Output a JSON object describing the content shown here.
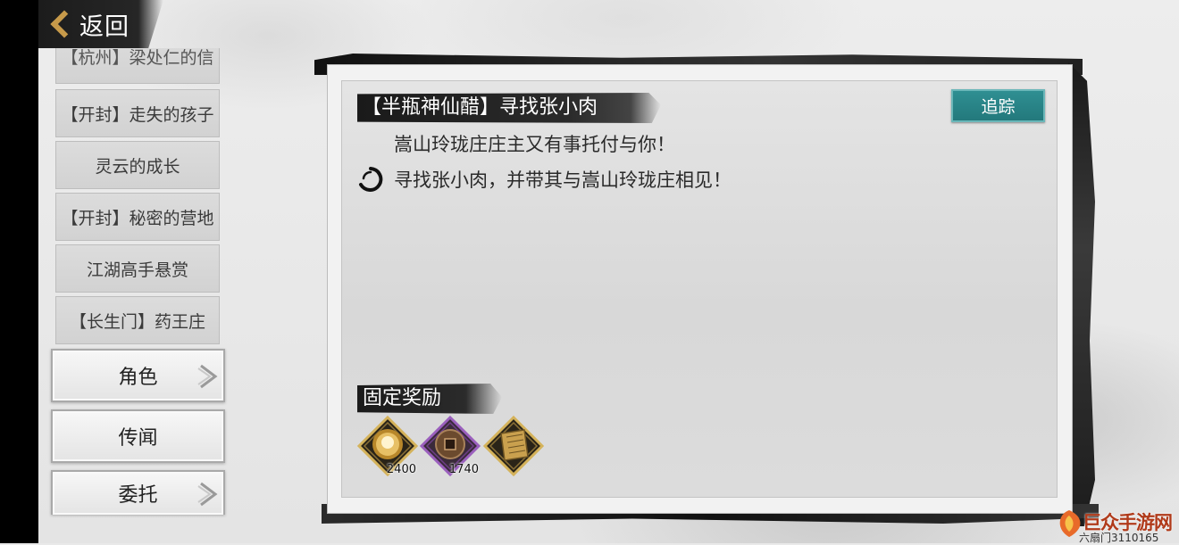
{
  "header": {
    "back_label": "返回"
  },
  "quest_list": [
    "【杭州】梁处仁的信",
    "【开封】走失的孩子",
    "灵云的成长",
    "【开封】秘密的营地",
    "江湖高手悬赏",
    "【长生门】药王庄"
  ],
  "categories": [
    {
      "label": "角色",
      "has_arrow": true
    },
    {
      "label": "传闻",
      "has_arrow": false
    },
    {
      "label": "委托",
      "has_arrow": true
    }
  ],
  "quest": {
    "title": "【半瓶神仙醋】寻找张小肉",
    "track_label": "追踪",
    "description": "嵩山玲珑庄庄主又有事托付与你！",
    "objective": "寻找张小肉，并带其与嵩山玲珑庄相见！"
  },
  "rewards": {
    "title": "固定奖励",
    "items": [
      {
        "icon": "gold-orb-icon",
        "count": "2400",
        "frame_color": "#c9a64a"
      },
      {
        "icon": "copper-coin-icon",
        "count": "1740",
        "frame_color": "#8a4fa8"
      },
      {
        "icon": "scroll-book-icon",
        "count": "",
        "frame_color": "#c9a64a"
      }
    ]
  },
  "watermark": {
    "title": "巨众手游网",
    "subtitle": "六扇门3110165"
  },
  "colors": {
    "track_button": "#2a8588",
    "ink": "#1a1a1a",
    "accent_gold": "#c79a4a"
  }
}
